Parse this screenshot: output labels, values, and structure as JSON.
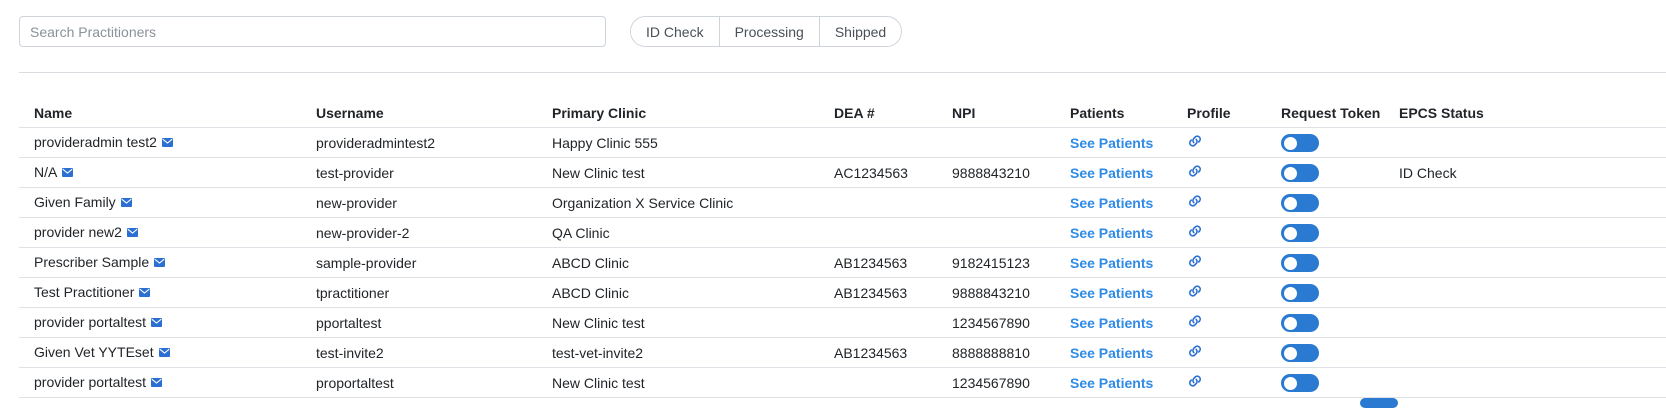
{
  "search": {
    "placeholder": "Search Practitioners",
    "value": ""
  },
  "filters": [
    "ID Check",
    "Processing",
    "Shipped"
  ],
  "table": {
    "headers": [
      "Name",
      "Username",
      "Primary Clinic",
      "DEA #",
      "NPI",
      "Patients",
      "Profile",
      "Request Token",
      "EPCS Status"
    ],
    "rows": [
      {
        "name": "provideradmin test2",
        "username": "provideradmintest2",
        "clinic": "Happy Clinic 555",
        "dea": "",
        "npi": "",
        "patients": "See Patients",
        "epcs": ""
      },
      {
        "name": "N/A",
        "username": "test-provider",
        "clinic": "New Clinic test",
        "dea": "AC1234563",
        "npi": "9888843210",
        "patients": "See Patients",
        "epcs": "ID Check"
      },
      {
        "name": "Given Family",
        "username": "new-provider",
        "clinic": "Organization X Service Clinic",
        "dea": "",
        "npi": "",
        "patients": "See Patients",
        "epcs": ""
      },
      {
        "name": "provider new2",
        "username": "new-provider-2",
        "clinic": "QA Clinic",
        "dea": "",
        "npi": "",
        "patients": "See Patients",
        "epcs": ""
      },
      {
        "name": "Prescriber Sample",
        "username": "sample-provider",
        "clinic": "ABCD Clinic",
        "dea": "AB1234563",
        "npi": "9182415123",
        "patients": "See Patients",
        "epcs": ""
      },
      {
        "name": "Test Practitioner",
        "username": "tpractitioner",
        "clinic": "ABCD Clinic",
        "dea": "AB1234563",
        "npi": "9888843210",
        "patients": "See Patients",
        "epcs": ""
      },
      {
        "name": "provider portaltest",
        "username": "pportaltest",
        "clinic": "New Clinic test",
        "dea": "",
        "npi": "1234567890",
        "patients": "See Patients",
        "epcs": ""
      },
      {
        "name": "Given Vet YYTEset",
        "username": "test-invite2",
        "clinic": "test-vet-invite2",
        "dea": "AB1234563",
        "npi": "8888888810",
        "patients": "See Patients",
        "epcs": ""
      },
      {
        "name": "provider portaltest",
        "username": "proportaltest",
        "clinic": "New Clinic test",
        "dea": "",
        "npi": "1234567890",
        "patients": "See Patients",
        "epcs": ""
      }
    ]
  },
  "icons": {
    "mail": "mail-icon",
    "profile": "link-icon"
  },
  "colors": {
    "link": "#2f8be6",
    "toggle": "#2a7ad2",
    "icon": "#2a6fd1"
  }
}
